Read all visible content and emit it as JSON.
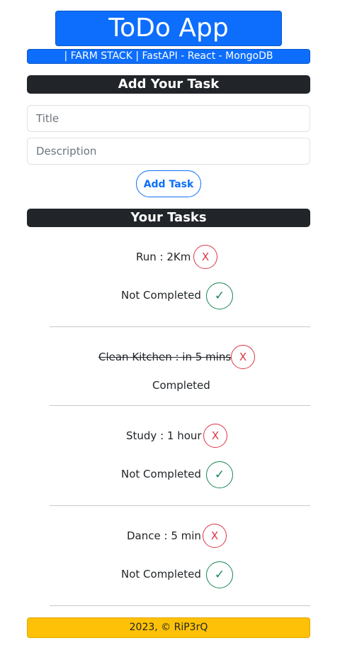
{
  "header": {
    "title": "ToDo App",
    "subtitle": "| FARM STACK | FastAPI - React - MongoDB"
  },
  "add_section": {
    "heading": "Add Your Task",
    "title_placeholder": "Title",
    "description_placeholder": "Description",
    "button_label": "Add Task"
  },
  "tasks_section": {
    "heading": "Your Tasks",
    "delete_label": "X",
    "complete_label": "✓",
    "tasks": [
      {
        "text": "Run : 2Km",
        "status": "Not Completed",
        "completed": false
      },
      {
        "text": "Clean Kitchen : in 5 mins",
        "status": "Completed",
        "completed": true
      },
      {
        "text": "Study : 1 hour",
        "status": "Not Completed",
        "completed": false
      },
      {
        "text": "Dance : 5 min",
        "status": "Not Completed",
        "completed": false
      }
    ]
  },
  "footer": {
    "text": "2023, © RiP3rQ"
  },
  "colors": {
    "primary": "#0d6efd",
    "dark": "#212529",
    "danger": "#dc3545",
    "success": "#198754",
    "warning": "#ffc107"
  }
}
